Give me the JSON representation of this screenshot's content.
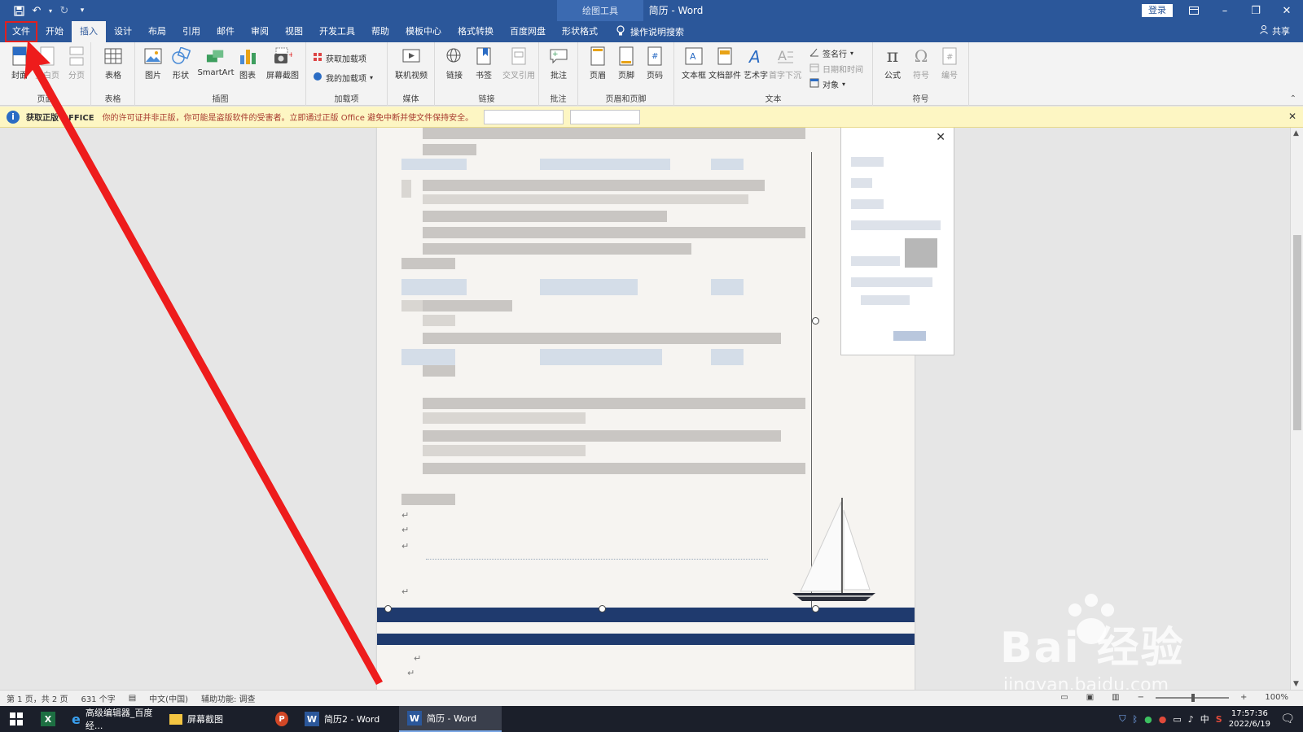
{
  "titlebar": {
    "context_tools": "绘图工具",
    "doc_title": "简历 - Word",
    "login": "登录"
  },
  "tabs": [
    {
      "label": "文件"
    },
    {
      "label": "开始"
    },
    {
      "label": "插入"
    },
    {
      "label": "设计"
    },
    {
      "label": "布局"
    },
    {
      "label": "引用"
    },
    {
      "label": "邮件"
    },
    {
      "label": "审阅"
    },
    {
      "label": "视图"
    },
    {
      "label": "开发工具"
    },
    {
      "label": "帮助"
    },
    {
      "label": "模板中心"
    },
    {
      "label": "格式转换"
    },
    {
      "label": "百度网盘"
    },
    {
      "label": "形状格式"
    }
  ],
  "tellme": "操作说明搜索",
  "share": "共享",
  "ribbon": {
    "groups": {
      "pages": "页面",
      "tables": "表格",
      "illustrations": "插图",
      "addins": "加载项",
      "media": "媒体",
      "links": "链接",
      "comments": "批注",
      "header_footer": "页眉和页脚",
      "text": "文本",
      "symbols": "符号"
    },
    "buttons": {
      "cover": "封面",
      "blank": "空白页",
      "pagebreak": "分页",
      "table": "表格",
      "picture": "图片",
      "shape": "形状",
      "smartart": "SmartArt",
      "chart": "图表",
      "screenshot": "屏幕截图",
      "get_addins": "获取加载项",
      "my_addins": "我的加载项",
      "online_video": "联机视频",
      "link": "链接",
      "bookmark": "书签",
      "crossref": "交叉引用",
      "comment": "批注",
      "header": "页眉",
      "footer": "页脚",
      "pagenum": "页码",
      "textbox": "文本框",
      "docparts": "文档部件",
      "wordart": "艺术字",
      "dropcap": "首字下沉",
      "sigline": "签名行",
      "datetime": "日期和时间",
      "object": "对象",
      "equation": "公式",
      "symbol": "符号",
      "numbering": "编号"
    }
  },
  "infobar": {
    "title": "获取正版 OFFICE",
    "text": "你的许可证并非正版，你可能是盗版软件的受害者。立即通过正版 Office 避免中断并使文件保持安全。"
  },
  "statusbar": {
    "pages": "第 1 页，共 2 页",
    "words": "631 个字",
    "language": "中文(中国)",
    "accessibility": "辅助功能: 调查",
    "zoom": "100%"
  },
  "taskbar": {
    "tasks": [
      {
        "label": "高级编辑器_百度经..."
      },
      {
        "label": "屏幕截图"
      },
      {
        "label": "简历2 - Word"
      },
      {
        "label": "简历 - Word"
      }
    ],
    "ime": "中",
    "time": "17:57:36",
    "date": "2022/6/19"
  },
  "watermark": {
    "brand": "Bai  经验",
    "url": "jingyan.baidu.com"
  },
  "colors": {
    "word_blue": "#2b579a",
    "highlight_red": "#e02020",
    "resume_navy": "#1f3a6e"
  }
}
